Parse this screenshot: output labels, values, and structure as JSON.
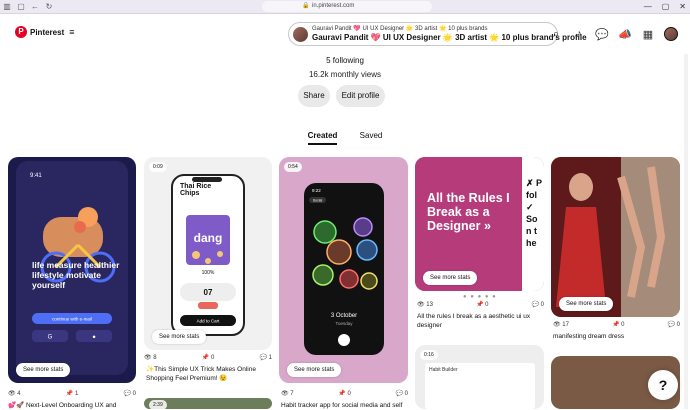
{
  "browser": {
    "url": "in.pinterest.com"
  },
  "header": {
    "brand": "Pinterest",
    "profile_line1": "Gauravi Pandit 💖 UI UX Designer 🌟 3D artist 🌟 10 plus brands",
    "profile_line2": "Gauravi Pandit 💖 UI UX Designer 🌟 3D artist 🌟 10 plus brand's profile"
  },
  "profile": {
    "following": "5 following",
    "views": "16.2k monthly views",
    "share_label": "Share",
    "edit_label": "Edit profile"
  },
  "tabs": {
    "created": "Created",
    "saved": "Saved"
  },
  "pins": [
    {
      "stats_label": "See more stats",
      "views": "4",
      "saves": "1",
      "comments": "0",
      "title": "💕🚀 Next-Level Onboarding UX and"
    },
    {
      "stats_label": "See more stats",
      "duration": "0:09",
      "views": "8",
      "saves": "0",
      "comments": "1",
      "title": "✨This Simple UX Trick Makes Online Shopping Feel Premium! 😉"
    },
    {
      "stats_label": "See more stats",
      "duration": "0:54",
      "views": "7",
      "saves": "0",
      "comments": "0",
      "title": "Habit tracker app for social media and self"
    },
    {
      "stats_label": "See more stats",
      "views": "13",
      "saves": "0",
      "comments": "0",
      "title": "All the rules I break as a aesthetic ui ux designer",
      "text": "All the Rules I Break as a Designer »"
    },
    {
      "stats_label": "See more stats",
      "views": "17",
      "saves": "0",
      "comments": "0",
      "title": "manifesting dream dress"
    },
    {
      "duration": "0:16",
      "text": "Habit Builder"
    }
  ],
  "pin_texts": {
    "bike": "life measure healthier lifestyle motivate yourself",
    "bike_button": "continue with e-mail",
    "bike_time": "9:41",
    "snack_brand": "Thai Rice Chips",
    "snack_pack": "dang",
    "snack_pct": "100%",
    "snack_qty": "07",
    "snack_btn": "Add to Cart",
    "habit_date": "3 October",
    "habit_day": "Tuesday",
    "habit_time": "9:22",
    "habit_tab_social": "Social",
    "side_text": "✗ P fol ✓ Son the",
    "pin7_time": "2:39"
  },
  "help": "?"
}
